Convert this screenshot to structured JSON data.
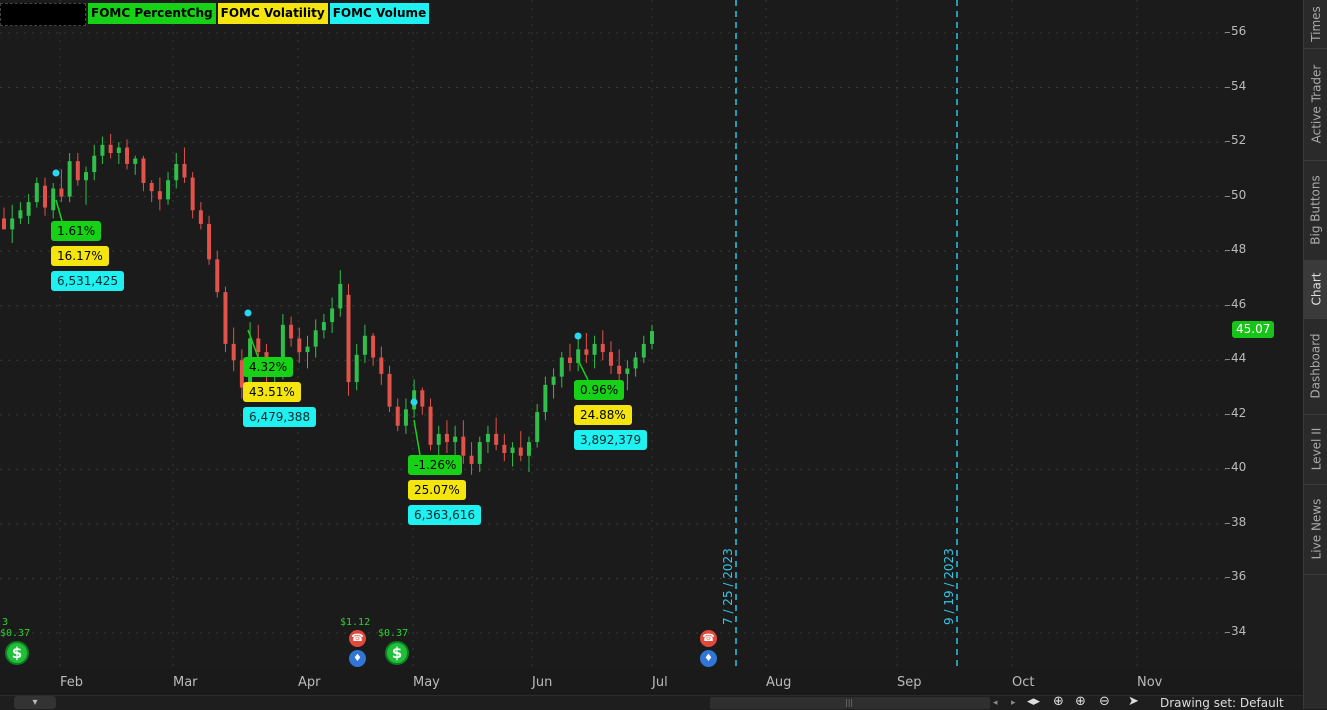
{
  "legend": [
    "FOMC PercentChg",
    "FOMC Volatility",
    "FOMC Volume"
  ],
  "price_axis": {
    "ticks": [
      "34",
      "36",
      "38",
      "40",
      "42",
      "44",
      "46",
      "48",
      "50",
      "52",
      "54",
      "56"
    ],
    "last_price": "45.07"
  },
  "x_axis": {
    "months": [
      "Feb",
      "Mar",
      "Apr",
      "May",
      "Jun",
      "Jul",
      "Aug",
      "Sep",
      "Oct",
      "Nov"
    ]
  },
  "fomc_labels": [
    {
      "pct": "1.61%",
      "vol": "16.17%",
      "volume": "6,531,425"
    },
    {
      "pct": "4.32%",
      "vol": "43.51%",
      "volume": "6,479,388"
    },
    {
      "pct": "-1.26%",
      "vol": "25.07%",
      "volume": "6,363,616"
    },
    {
      "pct": "0.96%",
      "vol": "24.88%",
      "volume": "3,892,379"
    }
  ],
  "future_dates": [
    "7 / 25 / 2023",
    "9 / 19 / 2023"
  ],
  "events": {
    "div1": "$0.37",
    "div1_prefix": "3",
    "earn_value": "$1.12",
    "div2": "$0.37"
  },
  "side_tabs": [
    "Times",
    "Active Trader",
    "Big Buttons",
    "Chart",
    "Dashboard",
    "Level II",
    "Live News"
  ],
  "bottom": {
    "drawing_set": "Drawing set: Default"
  },
  "icons": {
    "dividend": "dollar-icon",
    "earnings": "phone-icon",
    "conference": "bulb-icon"
  },
  "colors": {
    "up": "#2fbf4a",
    "down": "#e0524a",
    "background": "#1b1b1b",
    "fomc_marker": "#27d8f0"
  },
  "chart_data": {
    "type": "candlestick",
    "ylim": [
      33,
      57
    ],
    "months": [
      "Feb",
      "Mar",
      "Apr",
      "May",
      "Jun",
      "Jul",
      "Aug",
      "Sep",
      "Oct",
      "Nov"
    ],
    "candles": [
      [
        49.2,
        49.6,
        48.9,
        48.8
      ],
      [
        48.8,
        49.7,
        48.3,
        49.2
      ],
      [
        49.2,
        49.8,
        49.0,
        49.5
      ],
      [
        49.3,
        50.1,
        49.0,
        49.8
      ],
      [
        49.8,
        50.7,
        49.6,
        50.5
      ],
      [
        50.4,
        50.7,
        49.3,
        49.6
      ],
      [
        49.5,
        50.5,
        49.2,
        50.3
      ],
      [
        50.3,
        51.0,
        49.8,
        50.0
      ],
      [
        50.0,
        51.6,
        49.8,
        51.3
      ],
      [
        51.3,
        51.6,
        50.4,
        50.6
      ],
      [
        50.6,
        51.1,
        49.7,
        50.9
      ],
      [
        50.9,
        51.9,
        50.6,
        51.5
      ],
      [
        51.5,
        52.2,
        51.2,
        51.9
      ],
      [
        51.9,
        52.3,
        51.4,
        51.6
      ],
      [
        51.6,
        52.0,
        51.2,
        51.8
      ],
      [
        51.8,
        52.1,
        51.0,
        51.2
      ],
      [
        51.2,
        51.5,
        50.8,
        51.4
      ],
      [
        51.4,
        51.5,
        50.2,
        50.5
      ],
      [
        50.5,
        50.6,
        49.8,
        50.2
      ],
      [
        50.2,
        50.7,
        49.5,
        49.9
      ],
      [
        49.9,
        50.9,
        49.7,
        50.6
      ],
      [
        50.6,
        51.6,
        50.3,
        51.2
      ],
      [
        51.2,
        51.8,
        50.5,
        50.7
      ],
      [
        50.7,
        50.9,
        49.2,
        49.5
      ],
      [
        49.5,
        49.8,
        48.8,
        49.0
      ],
      [
        49.0,
        49.3,
        47.5,
        47.7
      ],
      [
        47.7,
        48.0,
        46.3,
        46.5
      ],
      [
        46.5,
        46.7,
        44.3,
        44.6
      ],
      [
        44.6,
        45.2,
        43.6,
        44.0
      ],
      [
        44.0,
        44.4,
        42.6,
        43.0
      ],
      [
        43.0,
        45.4,
        42.7,
        44.8
      ],
      [
        44.8,
        45.3,
        44.0,
        44.3
      ],
      [
        44.3,
        44.6,
        43.1,
        43.4
      ],
      [
        43.4,
        44.0,
        42.7,
        43.7
      ],
      [
        43.7,
        45.7,
        43.3,
        45.3
      ],
      [
        45.3,
        45.6,
        44.5,
        44.8
      ],
      [
        44.8,
        45.2,
        43.9,
        44.3
      ],
      [
        44.3,
        44.9,
        43.7,
        44.5
      ],
      [
        44.5,
        45.5,
        44.1,
        45.1
      ],
      [
        45.1,
        45.7,
        44.8,
        45.4
      ],
      [
        45.4,
        46.3,
        45.0,
        45.9
      ],
      [
        45.9,
        47.3,
        45.6,
        46.8
      ],
      [
        46.4,
        46.8,
        42.7,
        43.2
      ],
      [
        43.2,
        44.6,
        42.9,
        44.2
      ],
      [
        44.2,
        45.3,
        43.9,
        44.9
      ],
      [
        44.9,
        45.0,
        43.8,
        44.1
      ],
      [
        44.1,
        44.5,
        43.1,
        43.5
      ],
      [
        43.5,
        43.8,
        42.1,
        42.3
      ],
      [
        42.3,
        42.6,
        41.4,
        41.6
      ],
      [
        41.6,
        42.6,
        41.3,
        42.2
      ],
      [
        42.2,
        43.3,
        41.9,
        42.9
      ],
      [
        42.9,
        43.0,
        42.0,
        42.3
      ],
      [
        42.3,
        42.6,
        40.7,
        40.9
      ],
      [
        40.9,
        41.6,
        40.4,
        41.3
      ],
      [
        41.3,
        41.8,
        40.6,
        41.0
      ],
      [
        41.0,
        41.6,
        40.3,
        41.2
      ],
      [
        41.2,
        41.8,
        40.2,
        40.5
      ],
      [
        40.5,
        41.0,
        39.8,
        40.2
      ],
      [
        40.2,
        41.2,
        39.9,
        41.0
      ],
      [
        41.0,
        41.6,
        40.6,
        41.3
      ],
      [
        41.3,
        41.9,
        40.7,
        40.9
      ],
      [
        40.9,
        41.3,
        40.3,
        40.6
      ],
      [
        40.6,
        41.0,
        40.1,
        40.8
      ],
      [
        40.8,
        41.4,
        40.3,
        40.5
      ],
      [
        40.5,
        41.2,
        39.9,
        41.0
      ],
      [
        41.0,
        42.4,
        40.8,
        42.1
      ],
      [
        42.1,
        43.4,
        41.8,
        43.1
      ],
      [
        43.1,
        43.7,
        42.6,
        43.4
      ],
      [
        43.4,
        44.3,
        43.0,
        44.1
      ],
      [
        44.1,
        44.6,
        43.6,
        43.9
      ],
      [
        43.9,
        44.8,
        43.6,
        44.4
      ],
      [
        44.4,
        45.0,
        43.9,
        44.2
      ],
      [
        44.2,
        44.9,
        43.7,
        44.6
      ],
      [
        44.6,
        45.1,
        44.0,
        44.3
      ],
      [
        44.3,
        44.7,
        43.5,
        43.8
      ],
      [
        43.8,
        44.4,
        43.1,
        43.5
      ],
      [
        43.5,
        44.0,
        42.9,
        43.7
      ],
      [
        43.7,
        44.3,
        43.4,
        44.1
      ],
      [
        44.1,
        44.9,
        43.9,
        44.6
      ],
      [
        44.6,
        45.3,
        44.4,
        45.07
      ]
    ]
  }
}
